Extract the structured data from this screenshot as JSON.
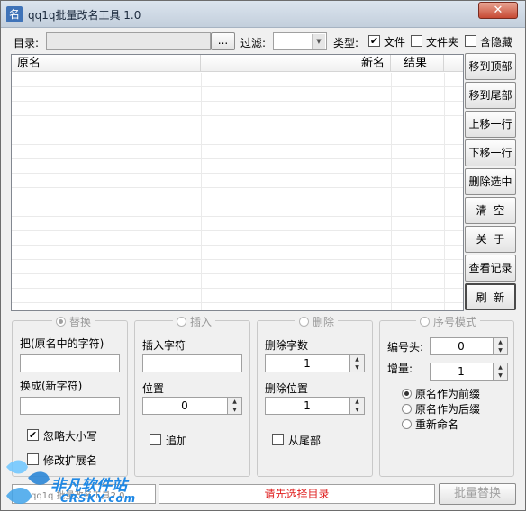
{
  "window": {
    "title": "qq1q批量改名工具 1.0",
    "close_label": "✕"
  },
  "toolbar": {
    "dir_label": "目录:",
    "dir_value": "",
    "browse_label": "...",
    "filter_label": "过滤:",
    "filter_value": "",
    "type_label": "类型:",
    "type_options": [
      {
        "label": "文件",
        "checked": true
      },
      {
        "label": "文件夹",
        "checked": false
      },
      {
        "label": "含隐藏",
        "checked": false
      }
    ]
  },
  "list": {
    "columns": [
      "原名",
      "新名",
      "结果"
    ]
  },
  "side_buttons": [
    "移到顶部",
    "移到尾部",
    "上移一行",
    "下移一行",
    "删除选中",
    "清  空",
    "关  于",
    "查看记录",
    "刷  新"
  ],
  "replace_group": {
    "legend": "替换",
    "from_label": "把(原名中的字符)",
    "from_value": "",
    "to_label": "换成(新字符)",
    "to_value": "",
    "ignore_case_label": "忽略大小写",
    "ignore_case_checked": true,
    "modify_ext_label": "修改扩展名",
    "modify_ext_checked": false
  },
  "insert_group": {
    "legend": "插入",
    "chars_label": "插入字符",
    "chars_value": "",
    "pos_label": "位置",
    "pos_value": "0",
    "append_label": "追加",
    "append_checked": false
  },
  "delete_group": {
    "legend": "删除",
    "count_label": "删除字数",
    "count_value": "1",
    "pos_label": "删除位置",
    "pos_value": "1",
    "from_end_label": "从尾部",
    "from_end_checked": false
  },
  "serial_group": {
    "legend": "序号模式",
    "prefix_label": "编号头:",
    "prefix_value": "0",
    "step_label": "增量:",
    "step_value": "1",
    "modes": [
      {
        "label": "原名作为前缀",
        "selected": true
      },
      {
        "label": "原名作为后缀",
        "selected": false
      },
      {
        "label": "重新命名",
        "selected": false
      }
    ]
  },
  "status": {
    "message": "请先选择目录",
    "message_color": "#e02020",
    "batch_button": "批量替换",
    "footer_text": "qq1q 批量改名工具2.0"
  },
  "watermark": {
    "brand": "非凡软件站",
    "domain": "CRSKY.com"
  }
}
